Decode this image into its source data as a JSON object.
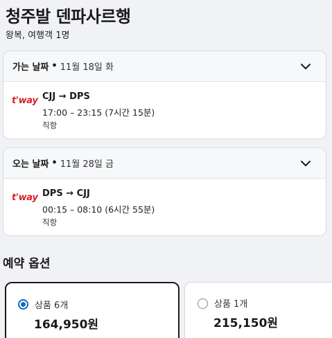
{
  "header": {
    "title": "청주발 덴파사르행",
    "subtitle": "왕복, 여행객 1명"
  },
  "flights": [
    {
      "direction_label": "가는 날짜",
      "bullet": "•",
      "date": "11월 18일 화",
      "airline_logo_text": "t'way",
      "route": "CJJ → DPS",
      "times": "17:00 – 23:15 (7시간 15분)",
      "stops": "직항"
    },
    {
      "direction_label": "오는 날짜",
      "bullet": "•",
      "date": "11월 28일 금",
      "airline_logo_text": "t'way",
      "route": "DPS → CJJ",
      "times": "00:15 – 08:10 (6시간 55분)",
      "stops": "직항"
    }
  ],
  "booking": {
    "title": "예약 옵션",
    "options": [
      {
        "label": "상품 6개",
        "price": "164,950원",
        "selected": true
      },
      {
        "label": "상품 1개",
        "price": "215,150원",
        "selected": false
      }
    ]
  },
  "colors": {
    "background": "#f1f2f5",
    "airline_brand": "#d7212a",
    "radio_selected": "#1268c4"
  },
  "icons": {
    "expand": "chevron-down-icon",
    "airline": "tway-logo"
  }
}
